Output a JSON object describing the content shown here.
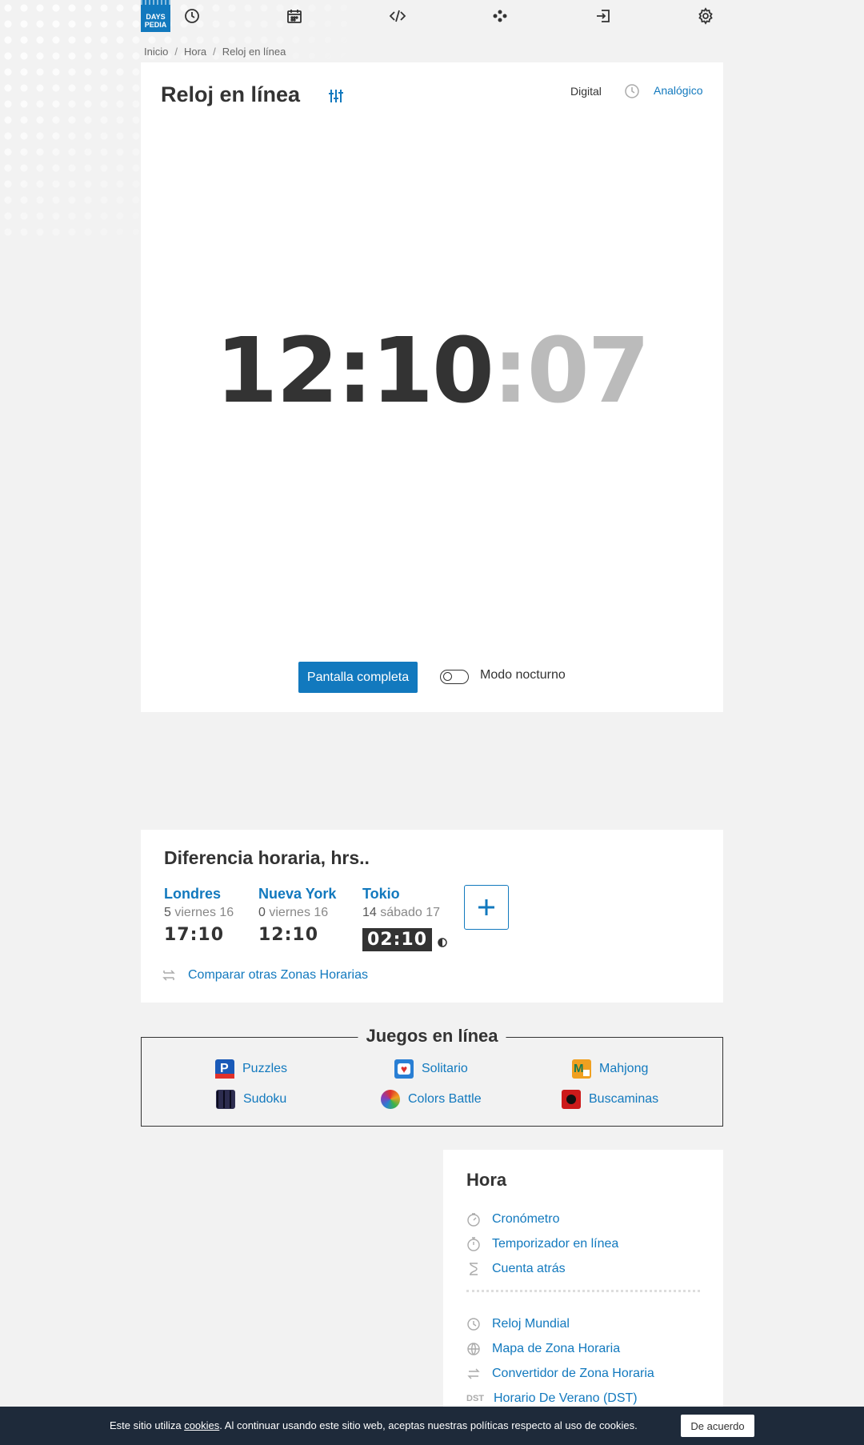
{
  "logo": {
    "line1": "DAYS",
    "line2": "PEDIA"
  },
  "nav": {
    "icons": [
      "clock-icon",
      "calendar-icon",
      "code-icon",
      "apps-icon",
      "login-icon",
      "settings-icon"
    ]
  },
  "breadcrumb": {
    "items": [
      "Inicio",
      "Hora",
      "Reloj en línea"
    ]
  },
  "clock": {
    "title": "Reloj en línea",
    "mode_digital": "Digital",
    "mode_analog": "Analógico",
    "time_hm": "12:10",
    "time_sec": ":07",
    "fullscreen_label": "Pantalla completa",
    "night_mode_label": "Modo nocturno",
    "night_mode_on": false
  },
  "diff": {
    "title": "Diferencia horaria, hrs..",
    "cities": [
      {
        "name": "Londres",
        "offset": "5",
        "day": "viernes 16",
        "time": "17:10",
        "night": false
      },
      {
        "name": "Nueva York",
        "offset": "0",
        "day": "viernes 16",
        "time": "12:10",
        "night": false
      },
      {
        "name": "Tokio",
        "offset": "14",
        "day": "sábado 17",
        "time": "02:10",
        "night": true
      }
    ],
    "compare_label": "Comparar otras Zonas Horarias"
  },
  "games": {
    "title": "Juegos en línea",
    "items": [
      "Puzzles",
      "Solitario",
      "Mahjong",
      "Sudoku",
      "Colors Battle",
      "Buscaminas"
    ]
  },
  "sidebar": {
    "title": "Hora",
    "items": [
      "Cronómetro",
      "Temporizador en línea",
      "Cuenta atrás",
      "Reloj Mundial",
      "Mapa de Zona Horaria",
      "Convertidor de Zona Horaria",
      "Horario De Verano (DST)"
    ],
    "dst_badge": "DST"
  },
  "cookie": {
    "text_before": "Este sitio utiliza ",
    "link": "cookies",
    "text_after": ". Al continuar usando este sitio web, aceptas nuestras políticas respecto al uso de cookies.",
    "accept_label": "De acuerdo"
  },
  "colors": {
    "accent": "#1279be",
    "text": "#333333",
    "background": "#f2f2f2"
  }
}
